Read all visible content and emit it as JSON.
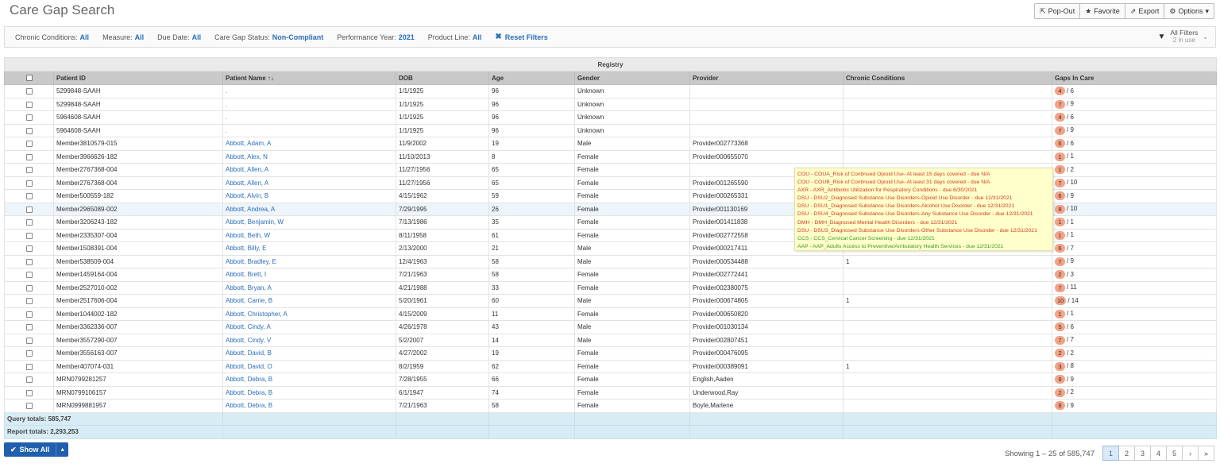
{
  "page_title": "Care Gap Search",
  "actions": {
    "popout": "Pop-Out",
    "favorite": "Favorite",
    "export": "Export",
    "options": "Options"
  },
  "filters": [
    {
      "label": "Chronic Conditions:",
      "value": "All"
    },
    {
      "label": "Measure:",
      "value": "All"
    },
    {
      "label": "Due Date:",
      "value": "All"
    },
    {
      "label": "Care Gap Status:",
      "value": "Non-Compliant"
    },
    {
      "label": "Performance Year:",
      "value": "2021"
    },
    {
      "label": "Product Line:",
      "value": "All"
    }
  ],
  "reset_filters": "Reset Filters",
  "all_filters": {
    "label": "All Filters",
    "sub": "2 in use"
  },
  "table": {
    "group_header": "Registry",
    "columns": [
      "Patient ID",
      "Patient Name ↑↓",
      "DOB",
      "Age",
      "Gender",
      "Provider",
      "Chronic Conditions",
      "Gaps In Care"
    ],
    "rows": [
      {
        "id": "5299848-SAAH",
        "name": ".",
        "dob": "1/1/1925",
        "age": "96",
        "gender": "Unknown",
        "provider": "",
        "chronic": "",
        "gaps": "4",
        "total": "/ 6"
      },
      {
        "id": "5299848-SAAH",
        "name": ".",
        "dob": "1/1/1925",
        "age": "96",
        "gender": "Unknown",
        "provider": "",
        "chronic": "",
        "gaps": "7",
        "total": "/ 9"
      },
      {
        "id": "5964608-SAAH",
        "name": ".",
        "dob": "1/1/1925",
        "age": "96",
        "gender": "Unknown",
        "provider": "",
        "chronic": "",
        "gaps": "4",
        "total": "/ 6"
      },
      {
        "id": "5964608-SAAH",
        "name": ".",
        "dob": "1/1/1925",
        "age": "96",
        "gender": "Unknown",
        "provider": "",
        "chronic": "",
        "gaps": "7",
        "total": "/ 9"
      },
      {
        "id": "Member3810579-015",
        "name": "Abbott, Adam, A",
        "dob": "11/9/2002",
        "age": "19",
        "gender": "Male",
        "provider": "Provider002773368",
        "chronic": "",
        "gaps": "6",
        "total": "/ 6"
      },
      {
        "id": "Member3966626-182",
        "name": "Abbott, Alex, N",
        "dob": "11/10/2013",
        "age": "8",
        "gender": "Female",
        "provider": "Provider000655070",
        "chronic": "",
        "gaps": "1",
        "total": "/ 1"
      },
      {
        "id": "Member2767368-004",
        "name": "Abbott, Allen, A",
        "dob": "11/27/1956",
        "age": "65",
        "gender": "Female",
        "provider": "",
        "chronic": "",
        "gaps": "1",
        "total": "/ 2"
      },
      {
        "id": "Member2767368-004",
        "name": "Abbott, Allen, A",
        "dob": "11/27/1956",
        "age": "65",
        "gender": "Female",
        "provider": "Provider001265590",
        "chronic": "",
        "gaps": "7",
        "total": "/ 10"
      },
      {
        "id": "Member500559-182",
        "name": "Abbott, Alvin, B",
        "dob": "4/15/1962",
        "age": "59",
        "gender": "Female",
        "provider": "Provider000265331",
        "chronic": "",
        "gaps": "6",
        "total": "/ 9"
      },
      {
        "id": "Member2965089-002",
        "name": "Abbott, Andrea, A",
        "dob": "7/29/1995",
        "age": "26",
        "gender": "Female",
        "provider": "Provider001130169",
        "chronic": "",
        "gaps": "8",
        "total": "/ 10"
      },
      {
        "id": "Member3206243-182",
        "name": "Abbott, Benjamin, W",
        "dob": "7/13/1986",
        "age": "35",
        "gender": "Female",
        "provider": "Provider001411838",
        "chronic": "",
        "gaps": "1",
        "total": "/ 1"
      },
      {
        "id": "Member2335307-004",
        "name": "Abbott, Beth, W",
        "dob": "8/11/1958",
        "age": "61",
        "gender": "Female",
        "provider": "Provider002772558",
        "chronic": "",
        "gaps": "1",
        "total": "/ 1"
      },
      {
        "id": "Member1508391-004",
        "name": "Abbott, Billy, E",
        "dob": "2/13/2000",
        "age": "21",
        "gender": "Male",
        "provider": "Provider000217411",
        "chronic": "",
        "gaps": "6",
        "total": "/ 7"
      },
      {
        "id": "Member538509-004",
        "name": "Abbott, Bradley, E",
        "dob": "12/4/1963",
        "age": "58",
        "gender": "Male",
        "provider": "Provider000534488",
        "chronic": "1",
        "gaps": "7",
        "total": "/ 9"
      },
      {
        "id": "Member1459164-004",
        "name": "Abbott, Brett, I",
        "dob": "7/21/1963",
        "age": "58",
        "gender": "Female",
        "provider": "Provider002772441",
        "chronic": "",
        "gaps": "2",
        "total": "/ 3"
      },
      {
        "id": "Member2527010-002",
        "name": "Abbott, Bryan, A",
        "dob": "4/21/1988",
        "age": "33",
        "gender": "Female",
        "provider": "Provider002380075",
        "chronic": "",
        "gaps": "7",
        "total": "/ 11"
      },
      {
        "id": "Member2517606-004",
        "name": "Abbott, Carrie, B",
        "dob": "5/20/1961",
        "age": "60",
        "gender": "Male",
        "provider": "Provider000674805",
        "chronic": "1",
        "gaps": "10",
        "total": "/ 14"
      },
      {
        "id": "Member1044002-182",
        "name": "Abbott, Christopher, A",
        "dob": "4/15/2009",
        "age": "11",
        "gender": "Female",
        "provider": "Provider000650820",
        "chronic": "",
        "gaps": "1",
        "total": "/ 1"
      },
      {
        "id": "Member3362336-007",
        "name": "Abbott, Cindy, A",
        "dob": "4/26/1978",
        "age": "43",
        "gender": "Male",
        "provider": "Provider001030134",
        "chronic": "",
        "gaps": "5",
        "total": "/ 6"
      },
      {
        "id": "Member3557290-007",
        "name": "Abbott, Cindy, V",
        "dob": "5/2/2007",
        "age": "14",
        "gender": "Male",
        "provider": "Provider002807451",
        "chronic": "",
        "gaps": "7",
        "total": "/ 7"
      },
      {
        "id": "Member3556163-007",
        "name": "Abbott, David, B",
        "dob": "4/27/2002",
        "age": "19",
        "gender": "Female",
        "provider": "Provider000476095",
        "chronic": "",
        "gaps": "2",
        "total": "/ 2"
      },
      {
        "id": "Member407074-031",
        "name": "Abbott, David, O",
        "dob": "8/2/1959",
        "age": "62",
        "gender": "Female",
        "provider": "Provider000389091",
        "chronic": "1",
        "gaps": "3",
        "total": "/ 8"
      },
      {
        "id": "MRN0799281257",
        "name": "Abbott, Debra, B",
        "dob": "7/28/1955",
        "age": "66",
        "gender": "Female",
        "provider": "English,Aaden",
        "chronic": "",
        "gaps": "9",
        "total": "/ 9"
      },
      {
        "id": "MRN0799106157",
        "name": "Abbott, Debra, B",
        "dob": "6/1/1947",
        "age": "74",
        "gender": "Female",
        "provider": "Underwood,Ray",
        "chronic": "",
        "gaps": "2",
        "total": "/ 2"
      },
      {
        "id": "MRN0999881957",
        "name": "Abbott, Debra, B",
        "dob": "7/21/1963",
        "age": "58",
        "gender": "Female",
        "provider": "Boyle,Marlene",
        "chronic": "",
        "gaps": "8",
        "total": "/ 9"
      }
    ],
    "highlight_row": 9,
    "query_totals": "Query totals: 585,747",
    "report_totals": "Report totals: 2,293,253"
  },
  "tooltip": [
    {
      "text": "COU - COUA_Risk of Continued Opioid Use- At least 15 days covered - due N/A",
      "status": "red"
    },
    {
      "text": "COU - COUB_Risk of Continued Opioid Use- At least 31 days covered - due N/A",
      "status": "red"
    },
    {
      "text": "AXR - AXR_Antibiotic Utilization for Respiratory Conditions - due 6/30/2021",
      "status": "red"
    },
    {
      "text": "DSU - DSU2_Diagnosed Substance Use Disorders-Opioid Use Disorder - due 12/31/2021",
      "status": "red"
    },
    {
      "text": "DSU - DSU1_Diagnosed Substance Use Disorders-Alcohol Use Disorder - due 12/31/2021",
      "status": "red"
    },
    {
      "text": "DSU - DSU4_Diagnosed Substance Use Disorders-Any Substance Use Disorder - due 12/31/2021",
      "status": "red"
    },
    {
      "text": "DMH - DMH_Diagnosed Mental Health Disorders - due 12/31/2021",
      "status": "red"
    },
    {
      "text": "DSU - DSU3_Diagnosed Substance Use Disorders-Other Substance Use Disorder - due 12/31/2021",
      "status": "red"
    },
    {
      "text": "CCS - CCS_Cervical Cancer Screening - due 12/31/2021",
      "status": "green"
    },
    {
      "text": "AAP - AAP_Adults Access to Preventive/Ambulatory Health Services - due 12/31/2021",
      "status": "green"
    }
  ],
  "show_all": "Show All",
  "showing": "Showing 1 – 25 of 585,747",
  "pager": {
    "pages": [
      "1",
      "2",
      "3",
      "4",
      "5"
    ],
    "next": "›",
    "last": "»",
    "current": "1"
  },
  "colors": {
    "link": "#2a6ebb",
    "badge": "#f2a287",
    "header": "#c9c9c9",
    "totals": "#d7ecf4",
    "tooltip_bg": "#ffffcc",
    "primary_button": "#1f5fae"
  },
  "icons": {
    "popout": "external-link-icon",
    "favorite": "star-icon",
    "export": "share-icon",
    "options": "gear-icon",
    "reset": "close-icon",
    "all_filters": "funnel-icon",
    "show_all": "check-icon"
  }
}
